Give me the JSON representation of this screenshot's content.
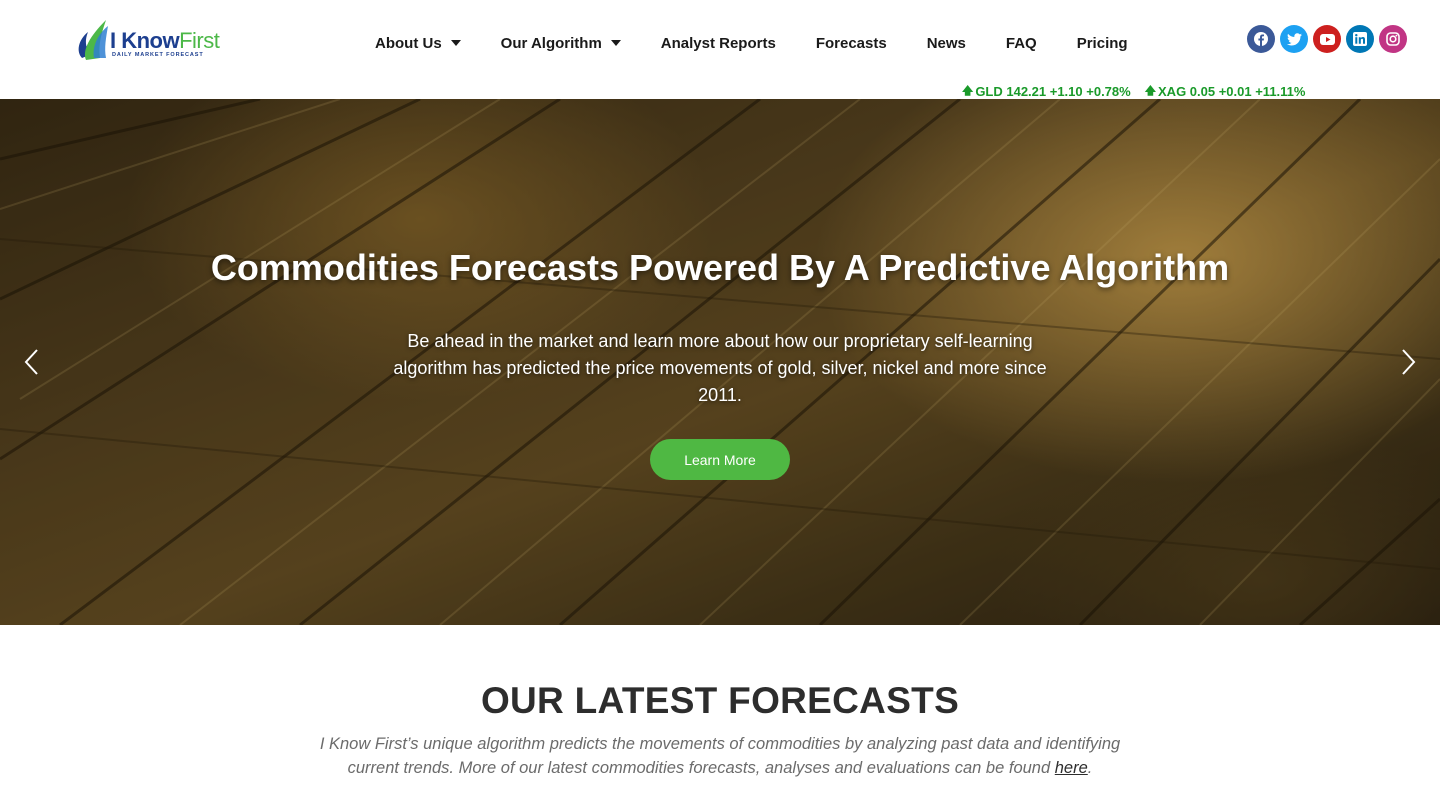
{
  "brand": {
    "name_part1": "I Know",
    "name_part2": "First",
    "tagline": "DAILY MARKET FORECAST",
    "colors": {
      "blue": "#1d3f8f",
      "green": "#4cb848"
    }
  },
  "nav": {
    "items": [
      {
        "label": "About Us",
        "has_dropdown": true
      },
      {
        "label": "Our Algorithm",
        "has_dropdown": true
      },
      {
        "label": "Analyst Reports",
        "has_dropdown": false
      },
      {
        "label": "Forecasts",
        "has_dropdown": false
      },
      {
        "label": "News",
        "has_dropdown": false
      },
      {
        "label": "FAQ",
        "has_dropdown": false
      },
      {
        "label": "Pricing",
        "has_dropdown": false
      }
    ]
  },
  "social": [
    {
      "icon": "facebook-icon",
      "color": "#3b5998"
    },
    {
      "icon": "twitter-icon",
      "color": "#1da1f2"
    },
    {
      "icon": "youtube-icon",
      "color": "#cd201f"
    },
    {
      "icon": "linkedin-icon",
      "color": "#0077b5"
    },
    {
      "icon": "instagram-icon",
      "color": "#c13584"
    }
  ],
  "ticker": [
    {
      "text": "GLD 142.21 +1.10 +0.78%",
      "direction": "up"
    },
    {
      "text": "XAG 0.05 +0.01 +11.11%",
      "direction": "up"
    }
  ],
  "hero": {
    "title": "Commodities Forecasts Powered By A Predictive Algorithm",
    "subtitle": "Be ahead in the market and learn more about how our proprietary self-learning algorithm has predicted the price movements of gold, silver, nickel and more since 2011.",
    "button_label": "Learn More",
    "button_color": "#4fb843"
  },
  "latest": {
    "title": "OUR LATEST FORECASTS",
    "description": "I Know First’s unique algorithm predicts the movements of commodities by analyzing past data and identifying current trends. More of our latest commodities forecasts, analyses and evaluations can be found ",
    "link_label": "here",
    "tail": "."
  }
}
